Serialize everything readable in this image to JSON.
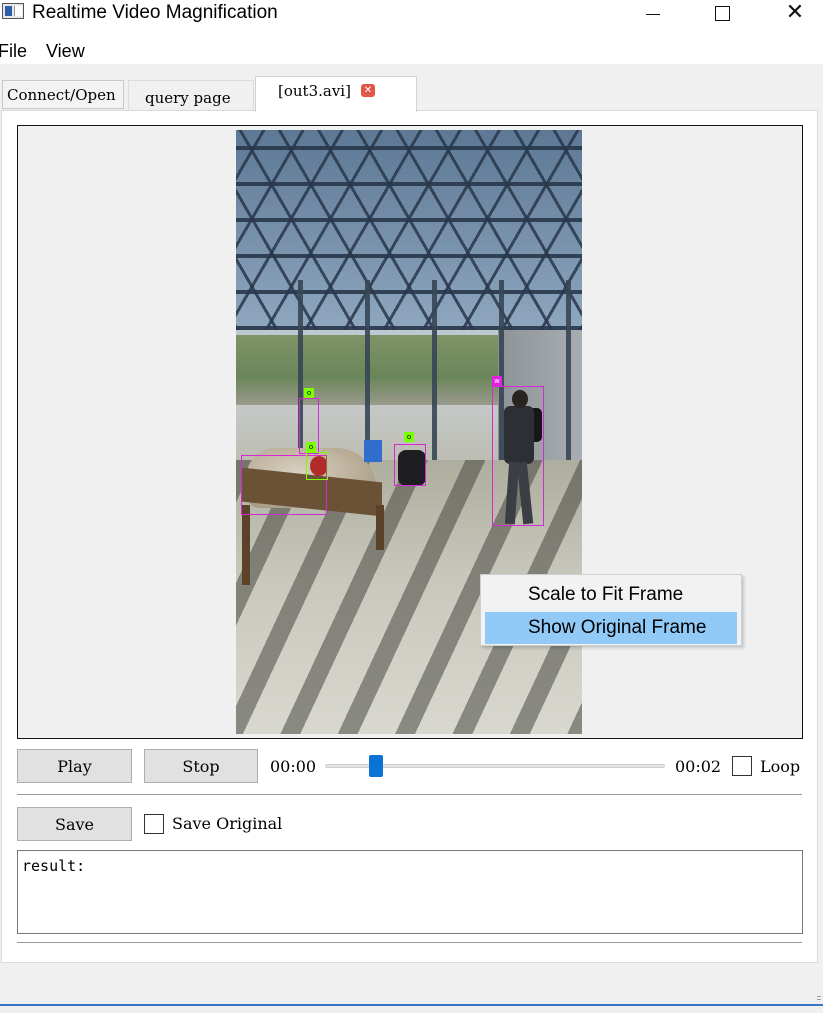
{
  "window": {
    "title": "Realtime Video Magnification",
    "minimize_icon": "minimize-icon",
    "maximize_icon": "maximize-icon",
    "close_icon": "close-icon"
  },
  "menubar": {
    "file": "File",
    "view": "View"
  },
  "tabs": [
    {
      "label": "Connect/Open"
    },
    {
      "label": "query page"
    },
    {
      "label": "[out3.avi]",
      "close_icon": "tab-close-icon",
      "active": true
    }
  ],
  "video": {
    "detections": [
      {
        "label": "o",
        "color": "#7cff00"
      },
      {
        "label": "o",
        "color": "#7cff00"
      },
      {
        "label": "o",
        "color": "#7cff00"
      },
      {
        "label": "w",
        "color": "#e021e0"
      }
    ]
  },
  "context_menu": {
    "items": [
      {
        "label": "Scale to Fit Frame",
        "highlighted": false
      },
      {
        "label": "Show Original Frame",
        "highlighted": true
      }
    ],
    "highlight_color": "#91c9f7"
  },
  "playback": {
    "play_label": "Play",
    "stop_label": "Stop",
    "time_current": "00:00",
    "time_total": "00:02",
    "position_fraction": 0.15,
    "loop_label": "Loop",
    "loop_checked": false,
    "accent_color": "#0a74d6"
  },
  "save": {
    "save_label": "Save",
    "save_original_label": "Save Original",
    "save_original_checked": false
  },
  "result": {
    "text": "result:"
  }
}
